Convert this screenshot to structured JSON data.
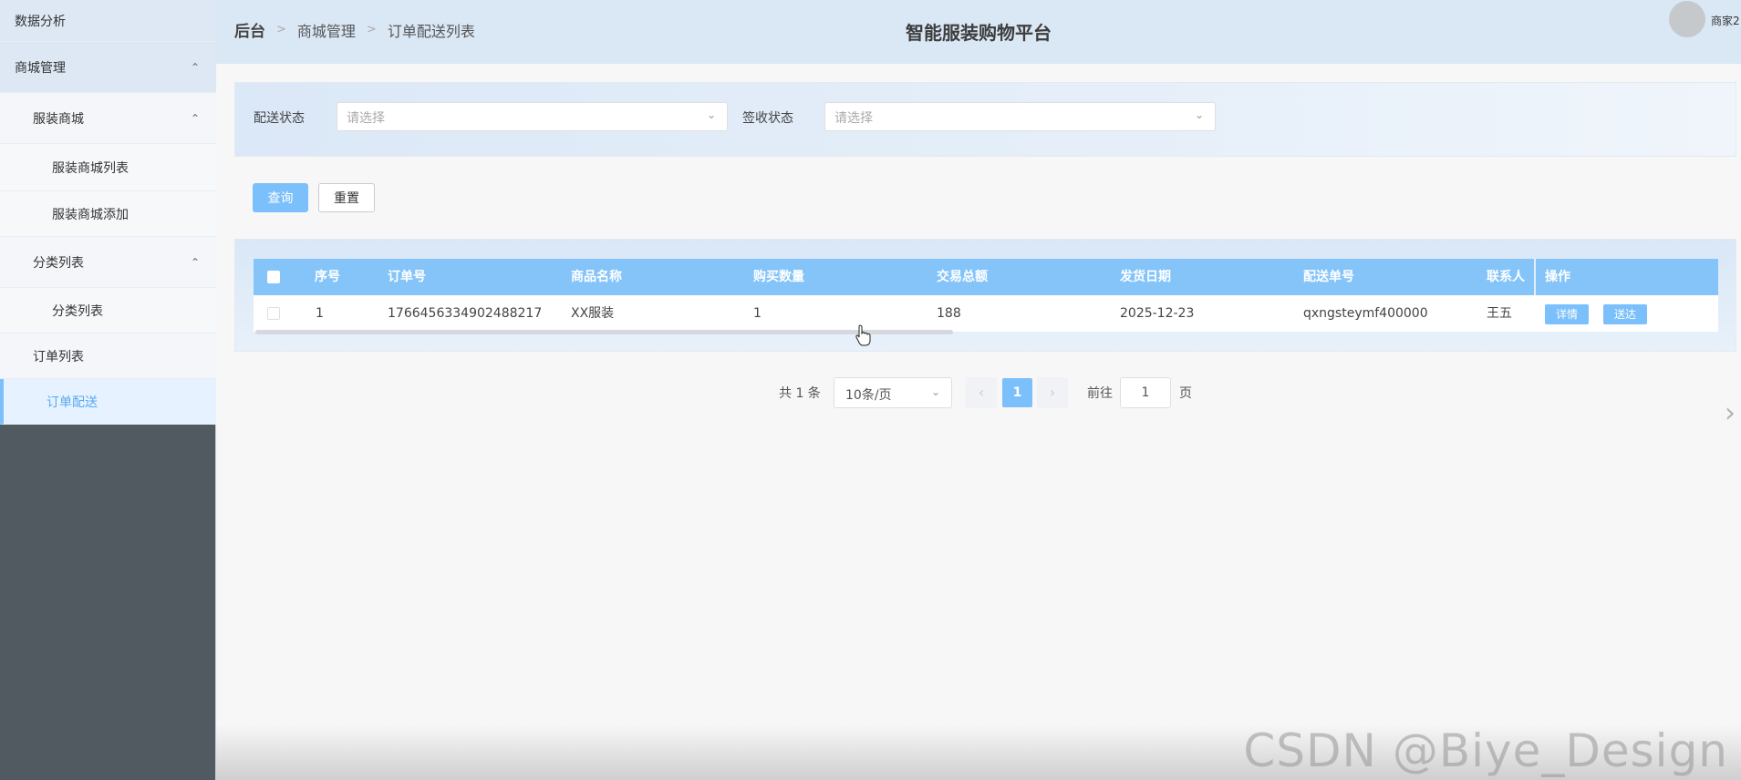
{
  "sidebar": {
    "items": [
      {
        "label": "数据分析"
      },
      {
        "label": "商城管理",
        "caret": "^"
      },
      {
        "label": "服装商城",
        "caret": "^"
      },
      {
        "label": "服装商城列表"
      },
      {
        "label": "服装商城添加"
      },
      {
        "label": "分类列表",
        "caret": "^"
      },
      {
        "label": "分类列表"
      },
      {
        "label": "订单列表"
      },
      {
        "label": "订单配送"
      }
    ]
  },
  "header": {
    "breadcrumb": [
      "后台",
      "商城管理",
      "订单配送列表"
    ],
    "title": "智能服装购物平台",
    "user_name": "商家2"
  },
  "search": {
    "delivery_status_label": "配送状态",
    "delivery_status_placeholder": "请选择",
    "sign_status_label": "签收状态",
    "sign_status_placeholder": "请选择",
    "query_button": "查询",
    "reset_button": "重置"
  },
  "table": {
    "columns": [
      "序号",
      "订单号",
      "商品名称",
      "购买数量",
      "交易总额",
      "发货日期",
      "配送单号",
      "联系人",
      "操作"
    ],
    "rows": [
      {
        "index": "1",
        "order_no": "1766456334902488217",
        "product": "XX服装",
        "quantity": "1",
        "total": "188",
        "ship_date": "2025-12-23",
        "delivery_no": "qxngsteymf400000",
        "contact": "王五",
        "actions": [
          "详情",
          "送达"
        ]
      }
    ]
  },
  "pagination": {
    "total": "共 1 条",
    "page_size": "10条/页",
    "current_page": "1",
    "goto_label": "前往",
    "goto_value": "1",
    "page_suffix": "页"
  },
  "watermark": "CSDN @Biye_Design",
  "colors": {
    "accent": "#7cc0fb",
    "table_header": "#84c4f9",
    "sidebar_dark": "#525a61"
  }
}
